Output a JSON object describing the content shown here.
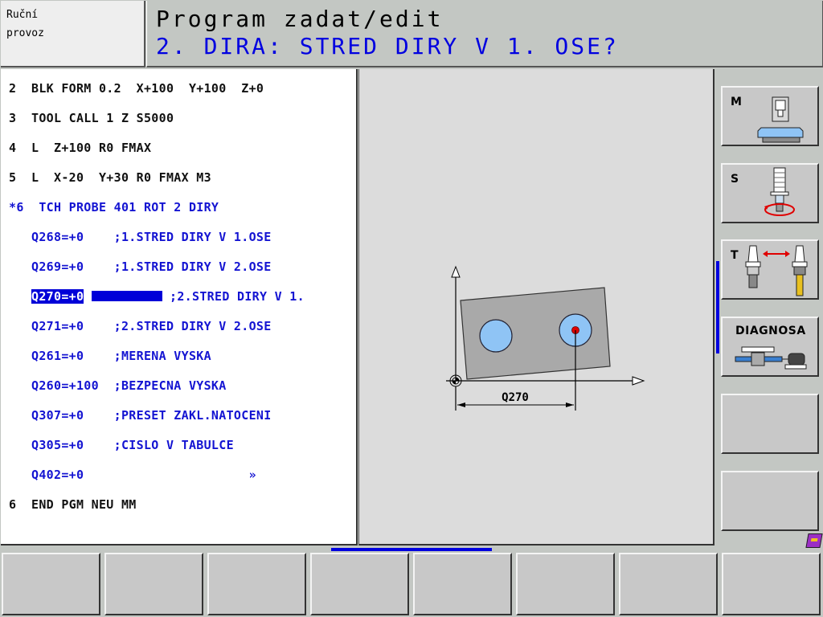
{
  "header": {
    "mode_line1": "Ruční",
    "mode_line2": "provoz",
    "title": "Program zadat/edit",
    "prompt": "2. DIRA: STRED DIRY V 1. OSE?"
  },
  "program": {
    "lines": [
      {
        "text": "2  BLK FORM 0.2  X+100  Y+100  Z+0",
        "color": "black"
      },
      {
        "text": "3  TOOL CALL 1 Z S5000",
        "color": "black"
      },
      {
        "text": "4  L  Z+100 R0 FMAX",
        "color": "black"
      },
      {
        "text": "5  L  X-20  Y+30 R0 FMAX M3",
        "color": "black"
      },
      {
        "text": "*6  TCH PROBE 401 ROT 2 DIRY",
        "color": "blue"
      },
      {
        "text": "   Q268=+0    ;1.STRED DIRY V 1.OSE",
        "color": "blue"
      },
      {
        "text": "   Q269=+0    ;1.STRED DIRY V 2.OSE",
        "color": "blue"
      },
      {
        "text": "",
        "color": "blue"
      },
      {
        "text": "   Q271=+0    ;2.STRED DIRY V 2.OSE",
        "color": "blue"
      },
      {
        "text": "   Q261=+0    ;MERENA VYSKA",
        "color": "blue"
      },
      {
        "text": "   Q260=+100  ;BEZPECNA VYSKA",
        "color": "blue"
      },
      {
        "text": "   Q307=+0    ;PRESET ZAKL.NATOCENI",
        "color": "blue"
      },
      {
        "text": "   Q305=+0    ;CISLO V TABULCE",
        "color": "blue"
      },
      {
        "text": "   Q402=+0                      »",
        "color": "blue"
      },
      {
        "text": "6  END PGM NEU MM",
        "color": "black"
      }
    ],
    "active_line": {
      "param": "Q270=+0",
      "comment": ";2.STRED DIRY V 1."
    }
  },
  "graphic": {
    "dimension_label": "Q270",
    "colors": {
      "workpiece": "#a9a9a9",
      "hole": "#8fc4f5",
      "point": "#e00000"
    }
  },
  "softkeys_right": [
    {
      "label": "M",
      "icon": "machine-table-icon"
    },
    {
      "label": "S",
      "icon": "spindle-rotation-icon"
    },
    {
      "label": "T",
      "icon": "tool-change-icon"
    },
    {
      "label": "DIAGNOSA",
      "icon": "diagnosis-drive-icon"
    },
    {
      "label": "",
      "icon": ""
    },
    {
      "label": "",
      "icon": ""
    }
  ],
  "softkeys_bottom": [
    "",
    "",
    "",
    "",
    "",
    "",
    "",
    ""
  ],
  "help_icon": "help-book-icon",
  "accent_color": "#0000e0"
}
